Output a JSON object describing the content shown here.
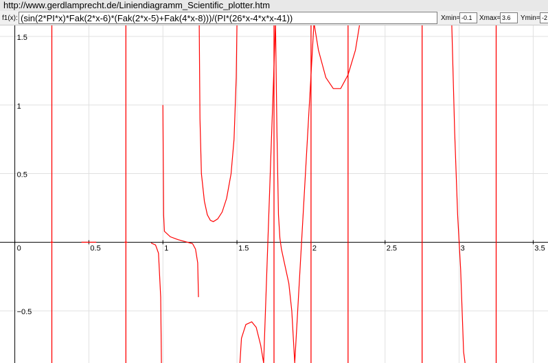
{
  "browser": {
    "url": "http://www.gerdlamprecht.de/Liniendiagramm_Scientific_plotter.htm"
  },
  "plotter": {
    "function_label": "f1(x):",
    "function_value": "(sin(2*PI*x)*Fak(2*x-6)*(Fak(2*x-5)+Fak(4*x-8)))/(PI*(26*x-4*x*x-41))",
    "xmin_label": "Xmin=",
    "xmin_value": "-0.1",
    "xmax_label": "Xmax=",
    "xmax_value": "3.6",
    "ymin_label": "Ymin=",
    "ymin_value": "-2"
  },
  "colors": {
    "curve": "#ff0000",
    "grid": "#e0e0e0",
    "axis": "#000000"
  },
  "chart_data": {
    "type": "line",
    "xlim": [
      -0.1,
      3.6
    ],
    "ylim": [
      -0.88,
      1.58
    ],
    "x_tick_labels": [
      "0",
      "0.5",
      "1",
      "1.5",
      "2",
      "2.5",
      "3",
      "3.5"
    ],
    "y_tick_labels": [
      "1.5",
      "1",
      "0.5",
      "−0.5"
    ],
    "grid": true,
    "vertical_asymptotes_x": [
      0.25,
      0.75,
      1.75,
      2.0,
      2.25,
      2.75,
      3.25
    ],
    "series": [
      {
        "points": [
          [
            -0.1,
            0
          ],
          [
            0.24,
            0
          ],
          [
            0.26,
            0
          ],
          [
            0.45,
            0
          ],
          [
            0.55,
            0
          ],
          [
            0.74,
            0
          ],
          [
            0.76,
            0
          ],
          [
            0.92,
            -0.005
          ],
          [
            0.95,
            -0.02
          ],
          [
            0.97,
            -0.08
          ],
          [
            0.985,
            -0.4
          ],
          [
            0.99,
            -0.9
          ],
          [
            1.0,
            1.0
          ],
          [
            1.005,
            0.2
          ],
          [
            1.01,
            0.08
          ],
          [
            1.05,
            0.04
          ],
          [
            1.1,
            0.02
          ],
          [
            1.15,
            0.005
          ],
          [
            1.2,
            -0.01
          ],
          [
            1.22,
            -0.05
          ],
          [
            1.235,
            -0.15
          ],
          [
            1.24,
            -0.4
          ],
          [
            1.245,
            1.6
          ],
          [
            1.25,
            0.9
          ],
          [
            1.26,
            0.5
          ],
          [
            1.28,
            0.3
          ],
          [
            1.3,
            0.2
          ],
          [
            1.32,
            0.16
          ],
          [
            1.34,
            0.15
          ],
          [
            1.37,
            0.17
          ],
          [
            1.4,
            0.22
          ],
          [
            1.43,
            0.32
          ],
          [
            1.46,
            0.5
          ],
          [
            1.48,
            0.75
          ],
          [
            1.495,
            1.2
          ],
          [
            1.5,
            1.6
          ],
          [
            1.52,
            -0.88
          ],
          [
            1.53,
            -0.7
          ],
          [
            1.56,
            -0.6
          ],
          [
            1.6,
            -0.58
          ],
          [
            1.63,
            -0.62
          ],
          [
            1.66,
            -0.75
          ],
          [
            1.68,
            -0.88
          ],
          [
            1.76,
            1.6
          ],
          [
            1.77,
            0.8
          ],
          [
            1.78,
            0.2
          ],
          [
            1.79,
            0.03
          ],
          [
            1.8,
            -0.05
          ],
          [
            1.82,
            -0.15
          ],
          [
            1.85,
            -0.3
          ],
          [
            1.87,
            -0.5
          ],
          [
            1.89,
            -0.88
          ],
          [
            2.02,
            1.6
          ],
          [
            2.05,
            1.4
          ],
          [
            2.1,
            1.2
          ],
          [
            2.15,
            1.12
          ],
          [
            2.2,
            1.12
          ],
          [
            2.25,
            1.22
          ],
          [
            2.3,
            1.4
          ],
          [
            2.33,
            1.6
          ],
          [
            2.95,
            1.6
          ],
          [
            2.97,
            0.8
          ],
          [
            2.99,
            0.2
          ],
          [
            3.0,
            0
          ],
          [
            3.01,
            -0.2
          ],
          [
            3.03,
            -0.8
          ],
          [
            3.04,
            -0.88
          ],
          [
            3.26,
            0
          ],
          [
            3.6,
            0
          ]
        ]
      }
    ]
  }
}
